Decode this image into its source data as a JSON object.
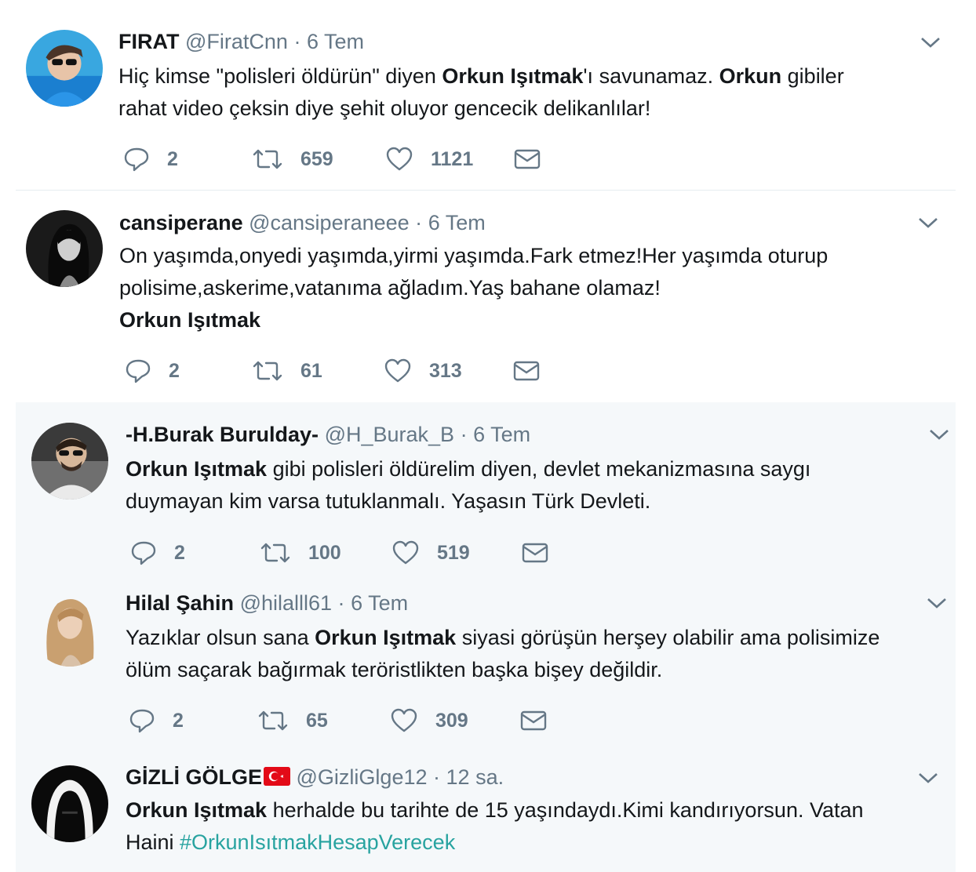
{
  "tweets": [
    {
      "name": "FIRAT",
      "handle": "@FiratCnn",
      "separator": "·",
      "time": "6 Tem",
      "text": [
        "Hiç kimse \"polisleri öldürün\" diyen ",
        "Orkun Işıtmak",
        "'ı savunamaz. ",
        "Orkun",
        " gibiler",
        "rahat video çeksin diye şehit oluyor gencecik delikanlılar!"
      ],
      "replies": "2",
      "retweets": "659",
      "likes": "1121"
    },
    {
      "name": "cansiperane",
      "handle": "@cansiperaneee",
      "separator": "·",
      "time": "6 Tem",
      "text": [
        "On yaşımda,onyedi yaşımda,yirmi yaşımda.Fark etmez!Her yaşımda oturup",
        "polisime,askerime,vatanıma ağladım.Yaş bahane olamaz!",
        "Orkun Işıtmak"
      ],
      "replies": "2",
      "retweets": "61",
      "likes": "313"
    },
    {
      "name": "-H.Burak Buruldaу-",
      "handle": "@H_Burak_B",
      "separator": "·",
      "time": "6 Tem",
      "text": [
        "Orkun Işıtmak",
        " gibi polisleri öldürelim diyen, devlet mekanizmasına saygı",
        "duymayan kim varsa tutuklanmalı. Yaşasın Türk Devleti."
      ],
      "replies": "2",
      "retweets": "100",
      "likes": "519"
    },
    {
      "name": "Hilal Şahin",
      "handle": "@hilalll61",
      "separator": "·",
      "time": "6 Tem",
      "text": [
        "Yazıklar olsun sana ",
        "Orkun Işıtmak",
        " siyasi görüşün herşey olabilir ama polisimize",
        "ölüm saçarak bağırmak teröristlikten başka bişey değildir."
      ],
      "replies": "2",
      "retweets": "65",
      "likes": "309"
    },
    {
      "name": "GİZLİ GÖLGE",
      "handle": "@GizliGlge12",
      "separator": "·",
      "time": "12 sa.",
      "text": [
        "Orkun Işıtmak",
        " herhalde bu tarihte de 15 yaşındaydı.Kimi kandırıyorsun. Vatan",
        "Haini ",
        "#OrkunIsıtmakHesapVerecek"
      ],
      "replies": "",
      "retweets": "",
      "likes": ""
    }
  ],
  "icons": {
    "reply": "speech-bubble-icon",
    "retweet": "retweet-arrows-icon",
    "like": "heart-icon",
    "dm": "envelope-icon",
    "more": "chevron-down-icon",
    "flag": "turkey-flag-icon"
  },
  "colors": {
    "name": "#14171a",
    "secondary": "#657786",
    "hashtag": "#28a3a0",
    "shaded_background": "#f5f8fa",
    "divider": "#e6ecf0",
    "flag": "#e30a17"
  }
}
